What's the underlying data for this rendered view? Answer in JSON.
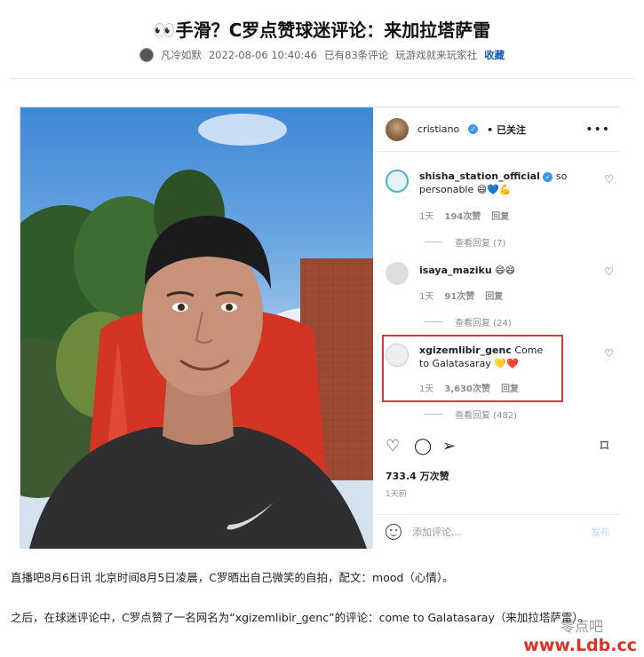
{
  "article": {
    "title": "👀手滑？C罗点赞球迷评论：来加拉塔萨雷",
    "author": "凡冷如默",
    "timestamp": "2022-08-06 10:40:46",
    "comment_count": "已有83条评论",
    "source": "玩游戏就来玩家社",
    "favorite": "收藏"
  },
  "instagram": {
    "username": "cristiano",
    "follow_state": "• 已关注",
    "comments": [
      {
        "user": "shisha_station_official",
        "text": "so personable 😄💙💪",
        "time": "1天",
        "likes": "194次赞",
        "reply": "回复",
        "view_replies": "查看回复 (7)"
      },
      {
        "user": "isaya_maziku",
        "text": "😄😄",
        "time": "1天",
        "likes": "91次赞",
        "reply": "回复",
        "view_replies": "查看回复 (24)"
      },
      {
        "user": "xgizemlibir_genc",
        "text": "Come to Galatasaray 💛❤️",
        "time": "1天",
        "likes": "3,630次赞",
        "reply": "回复",
        "view_replies": "查看回复 (482)"
      }
    ],
    "total_likes": "733.4 万次赞",
    "posted_ago": "1天前",
    "add_comment_placeholder": "添加评论...",
    "post_button": "发布"
  },
  "body": {
    "paragraph1": "直播吧8月6日讯  北京时间8月5日凌晨，C罗晒出自己微笑的自拍，配文：mood（心情）。",
    "paragraph2": "之后，在球迷评论中，C罗点赞了一名网名为“xgizemlibir_genc”的评论：come to Galatasaray（来加拉塔萨雷）。"
  },
  "watermark": {
    "line1": "零点吧",
    "line2": "www.Ldb.cc"
  },
  "colors": {
    "highlight_box": "#d23b3b",
    "verified_badge": "#3897f0",
    "watermark_red": "#e0302b"
  }
}
